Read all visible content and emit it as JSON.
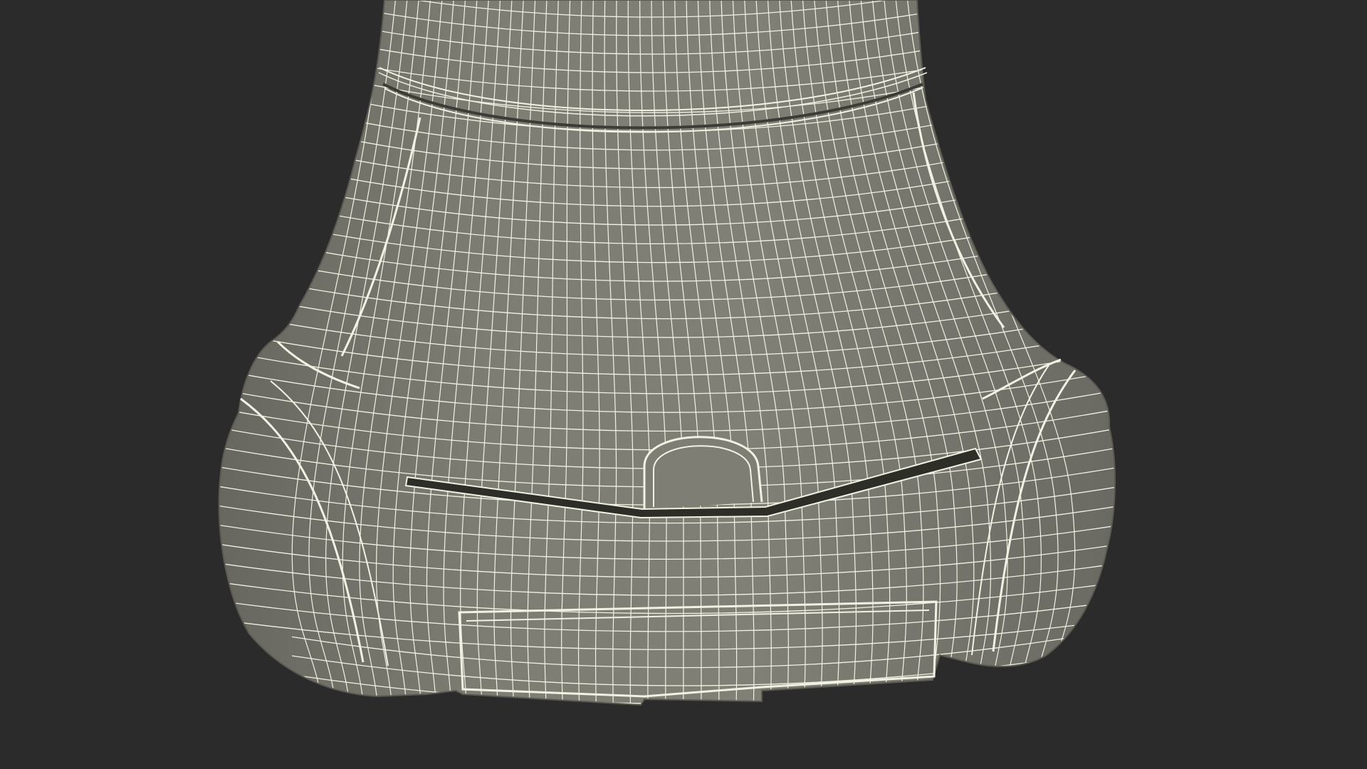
{
  "scene": {
    "subject": "wireframe-mesh-object",
    "view": "3d-render-wireframe-on-shaded"
  },
  "colors": {
    "background": "#2b2b2b",
    "surface": "#7b7b71",
    "surface_light": "#86867c",
    "surface_dark": "#5c5c55",
    "wire": "#f2f2e4",
    "slot_shadow": "#2e2e28"
  }
}
